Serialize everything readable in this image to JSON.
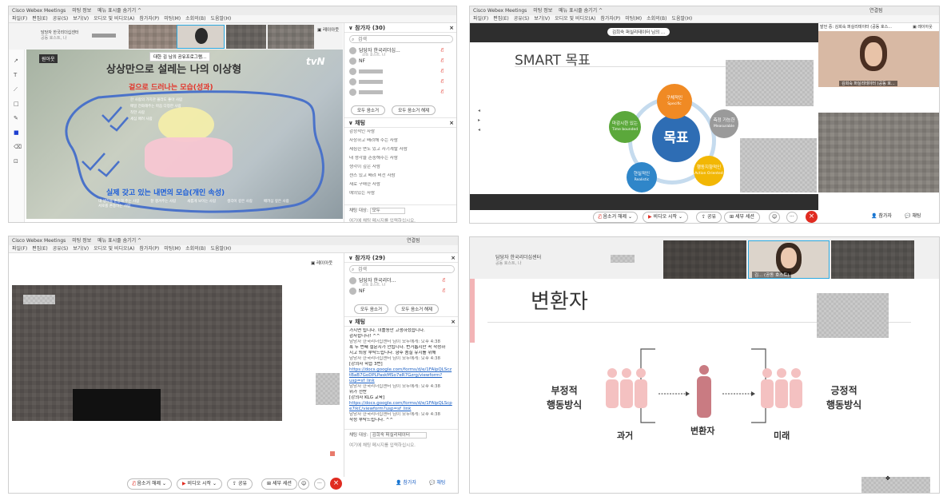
{
  "q1": {
    "app_title": "Cisco Webex Meetings",
    "meeting_info": "미팅 정보",
    "hide_menu": "메뉴 표시줄 숨기기 ^",
    "menu": [
      "파일(F)",
      "편집(E)",
      "공유(S)",
      "보기(V)",
      "오디오 및 비디오(A)",
      "참가자(P)",
      "미팅(M)",
      "소회의(B)",
      "도움말(H)"
    ],
    "host_label": "담당자 한국리더십센터",
    "host_sub": "공동 호스트, 나",
    "shared_tooltip": "대한 김 님의 공유프로그램...",
    "layout_btn": "레이아웃",
    "slide_title": "상상만으로 설레는 나의 이상형",
    "slide_red": "겉으로 드러나는 모습(성과)",
    "slide_blue": "실제 갖고 있는 내면의 모습(개인 속성)",
    "slide_logo": "tvN",
    "slide_tag": "원아웃",
    "slide_notes_top": [
      "한 사람의 가치관 몰라도 좋아 사람",
      "매일 전화해주는 마음 다정한 사람",
      "착한 사람",
      "세심 배려 사람"
    ],
    "slide_notes_bottom": [
      "내 생각을 존중해 주는 사람",
      "잘 챙겨주는 사람",
      "새롭게 보이는 사람",
      "생각이 깊은 사람",
      "배려심 깊은 사람",
      "서로를 존중하는 사람"
    ],
    "participants_header": "참가자 (30)",
    "search_placeholder": "검색",
    "participants": [
      {
        "name": "담당자 한국리더십...",
        "sub": "공동 호스트, 나"
      },
      {
        "name": "NF",
        "sub": ""
      },
      {
        "name": "",
        "sub": ""
      },
      {
        "name": "",
        "sub": ""
      },
      {
        "name": "",
        "sub": ""
      }
    ],
    "mute_all": "모두 음소거",
    "unmute_all": "모두 음소거 해제",
    "chat_header": "채팅",
    "chat_lines": [
      "감정적인 사람",
      "자상하고 배려해 주는 사람",
      "세심한 면도 있고 자기계발 사람",
      "내 생각을 존중해주는 사람",
      "생각이 깊은 사람",
      "센스 있고 배려 비전 사람",
      "새로 구매한 사람",
      "예의있는 사람"
    ],
    "chat_to_label": "채팅 대상:",
    "chat_to_value": "모두",
    "chat_input_placeholder": "여기에 채팅 메시지를 입력하십시오."
  },
  "q2": {
    "app_title": "Cisco Webex Meetings",
    "meeting_info": "미팅 정보",
    "hide_menu": "메뉴 표시줄 숨기기 ^",
    "menu": [
      "파일(F)",
      "편집(E)",
      "공유(S)",
      "보기(V)",
      "오디오 및 비디오(A)",
      "참가자(P)",
      "미팅(M)",
      "소회의(B)",
      "도움말(H)"
    ],
    "connected": "연결됨",
    "share_banner": "김희숙 퍼실리테이터 님의 ...",
    "speaker_label": "발언 중: 김희숙 퍼실리테이터 (공동 호스...",
    "layout_btn": "레이아웃",
    "speaker_name_tag": "김희숙 퍼실리테이터 (공동 호...",
    "slide_title": "SMART 목표",
    "center_label": "목표",
    "nodes": [
      {
        "ko": "구체적인",
        "en": "Specific",
        "color": "#f08a24"
      },
      {
        "ko": "측정 가능한",
        "en": "Measurable",
        "color": "#9a9a9a"
      },
      {
        "ko": "행동지향적인",
        "en": "Action Oriented",
        "color": "#f2b705"
      },
      {
        "ko": "현실적인",
        "en": "Realistic",
        "color": "#2f86c9"
      },
      {
        "ko": "마감시한 있는",
        "en": "Time bounded",
        "color": "#5ba83b"
      }
    ],
    "controls": {
      "mute": "음소거 해제",
      "video": "비디오 시작",
      "share": "공유",
      "breakout": "세부 세션",
      "participants": "참가자",
      "chat": "채팅"
    },
    "colors": {
      "center": "#2e6db4",
      "end": "#e02b20"
    }
  },
  "q3": {
    "app_title": "Cisco Webex Meetings",
    "meeting_info": "미팅 정보",
    "hide_menu": "메뉴 표시줄 숨기기 ^",
    "menu": [
      "파일(F)",
      "편집(E)",
      "공유(S)",
      "보기(V)",
      "오디오 및 비디오(A)",
      "참가자(P)",
      "미팅(M)",
      "소회의(B)",
      "도움말(H)"
    ],
    "connected": "연결됨",
    "layout_btn": "레이아웃",
    "participants_header": "참가자 (29)",
    "search_placeholder": "검색",
    "participants": [
      {
        "name": "담당자 한국리더...",
        "sub": "공동 호스트, 나"
      },
      {
        "name": "NF",
        "sub": ""
      }
    ],
    "mute_all": "모두 음소거",
    "unmute_all": "모두 음소거 해제",
    "chat_header": "채팅",
    "chat_lines": [
      {
        "t": "가시면 됩니다. 이틀동안 고생하셨습니다.",
        "k": "d"
      },
      {
        "t": "감사합니다! ^^",
        "k": "d"
      },
      {
        "t": "담당자 한국리더십센터 님이 모두에게:  오후 4:38",
        "k": ""
      },
      {
        "t": "혹 두 번째 설문지가 안됩니다. 번거롭지만 꼭 작성하",
        "k": "d"
      },
      {
        "t": "시고 퇴장 부탁드립니다. 향후 품질 유지를 위해",
        "k": "d"
      },
      {
        "t": "담당자 한국리더십센터 님이 모두에게:  오후 4:38",
        "k": ""
      },
      {
        "t": "[강의자 학습 3번]",
        "k": "d"
      },
      {
        "t": "https://docs.google.com/forms/d/e/1FAIpQLScz",
        "k": "u"
      },
      {
        "t": "tBaB7GoDPLPaskMSo7eR7Gzrg/viewform?",
        "k": "u"
      },
      {
        "t": "usp=sf_link",
        "k": "u"
      },
      {
        "t": "담당자 한국리더십센터 님이 모두에게:  오후 4:38",
        "k": ""
      },
      {
        "t": "위가 전반",
        "k": "d"
      },
      {
        "t": "[강의자 KLG 교육]",
        "k": "d"
      },
      {
        "t": "https://docs.google.com/forms/d/e/1FAIpQLScp",
        "k": "u"
      },
      {
        "t": "e7ikC/viewform?usp=sf_link",
        "k": "u"
      },
      {
        "t": "담당자 한국리더십센터 님이 모두에게:  오후 4:38",
        "k": ""
      },
      {
        "t": "작성 부탁드립니다. ^^",
        "k": "d"
      }
    ],
    "chat_to_label": "채팅 대상:",
    "chat_to_value": "김희숙 퍼실리테이터",
    "chat_input_placeholder": "여기에 채팅 메시지를 입력하십시오.",
    "controls": {
      "mute": "음소거 해제",
      "video": "비디오 시작",
      "share": "공유",
      "breakout": "세부 세션",
      "participants": "참가자",
      "chat": "채팅"
    }
  },
  "q4": {
    "host_label": "담당자 한국리더십센터",
    "host_sub": "공동 호스트, 나",
    "speaker_tag": "김... (공동 호스트)",
    "slide_title": "변환자",
    "left_label": "부정적\n행동방식",
    "right_label": "긍정적\n행동방식",
    "past": "과거",
    "transformer": "변환자",
    "future": "미래",
    "colors": {
      "pink": "#f4c1c1",
      "dark": "#c97b82"
    }
  }
}
